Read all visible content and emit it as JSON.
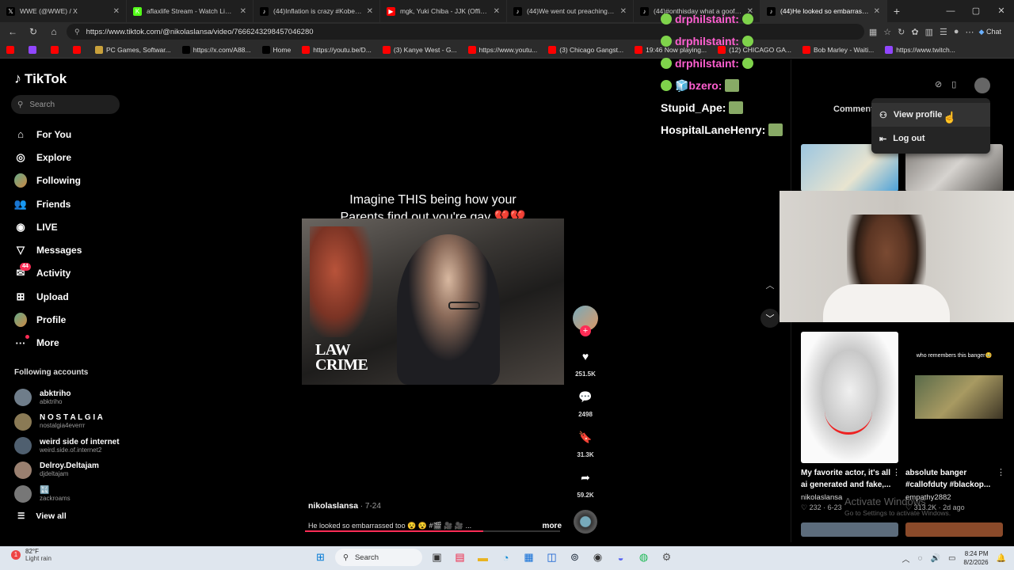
{
  "browser": {
    "tabs": [
      {
        "label": "WWE (@WWE) / X",
        "icon": "x-icon",
        "color": "#000000",
        "glyph": "𝕏"
      },
      {
        "label": "aflaxlife Stream - Watch Live on K",
        "icon": "kick-icon",
        "color": "#53fc18",
        "glyph": "K"
      },
      {
        "label": "(44)Inflation is crazy #Kobe | TikTok",
        "icon": "tiktok-icon",
        "color": "#000000",
        "glyph": "♪"
      },
      {
        "label": "mgk, Yuki Chiba - JJK (Official Vide",
        "icon": "youtube-icon",
        "color": "#ff0000",
        "glyph": "▶"
      },
      {
        "label": "(44)We went out preaching the G",
        "icon": "tiktok-icon",
        "color": "#000000",
        "glyph": "♪"
      },
      {
        "label": "(44)#onthisday what a goofball #",
        "icon": "tiktok-icon",
        "color": "#000000",
        "glyph": "♪"
      },
      {
        "label": "(44)He looked so embarrasse",
        "icon": "tiktok-icon",
        "color": "#000000",
        "glyph": "♪",
        "active": true
      }
    ],
    "url": "https://www.tiktok.com/@nikolaslansa/video/7666243298457046280",
    "chat_label": "Chat",
    "bookmarks": [
      {
        "label": "",
        "color": "#ff0000"
      },
      {
        "label": "",
        "color": "#9146ff"
      },
      {
        "label": "",
        "color": "#ff0000"
      },
      {
        "label": "",
        "color": "#ff0000"
      },
      {
        "label": "PC Games, Softwar...",
        "color": "#c9a13b"
      },
      {
        "label": "https://x.com/A88...",
        "color": "#000000"
      },
      {
        "label": "Home",
        "color": "#000000"
      },
      {
        "label": "https://youtu.be/D...",
        "color": "#ff0000"
      },
      {
        "label": "(3) Kanye West - G...",
        "color": "#ff0000"
      },
      {
        "label": "https://www.youtu...",
        "color": "#ff0000"
      },
      {
        "label": "(3) Chicago Gangst...",
        "color": "#ff0000"
      },
      {
        "label": "19:46 Now playing...",
        "color": "#ff0000"
      },
      {
        "label": "(12) CHICAGO GA...",
        "color": "#ff0000"
      },
      {
        "label": "Bob Marley - Waiti...",
        "color": "#ff0000"
      },
      {
        "label": "https://www.twitch...",
        "color": "#9146ff"
      }
    ]
  },
  "tiktok": {
    "logo": "TikTok",
    "search_placeholder": "Search",
    "nav": [
      {
        "label": "For You",
        "icon": "home-icon",
        "glyph": "⌂"
      },
      {
        "label": "Explore",
        "icon": "compass-icon",
        "glyph": "◎"
      },
      {
        "label": "Following",
        "icon": "following-avatar-icon",
        "glyph": ""
      },
      {
        "label": "Friends",
        "icon": "friends-icon",
        "glyph": "👥"
      },
      {
        "label": "LIVE",
        "icon": "live-icon",
        "glyph": "◉"
      },
      {
        "label": "Messages",
        "icon": "messages-icon",
        "glyph": "▽"
      },
      {
        "label": "Activity",
        "icon": "activity-icon",
        "glyph": "✉",
        "badge": "44"
      },
      {
        "label": "Upload",
        "icon": "upload-icon",
        "glyph": "⊞"
      },
      {
        "label": "Profile",
        "icon": "profile-avatar-icon",
        "glyph": ""
      },
      {
        "label": "More",
        "icon": "more-icon",
        "glyph": "···"
      }
    ],
    "following_title": "Following accounts",
    "following": [
      {
        "name": "abktriho",
        "user": "abktriho"
      },
      {
        "name": "N O S T A L G I A",
        "user": "nostalgia4everrr"
      },
      {
        "name": "weird side of internet",
        "user": "weird.side.of.internet2"
      },
      {
        "name": "Delroy.Deltajam",
        "user": "djdeltajam"
      },
      {
        "name": "🔣",
        "user": "zackroams"
      }
    ],
    "view_all": "View all"
  },
  "video": {
    "caption_line1": "Imagine THIS being how your",
    "caption_line2": "Parents find out you're gay 💔💔",
    "watermark_line1": "LAW",
    "watermark_line2": "CRIME",
    "author": "nikolaslansa",
    "date": " · 7-24",
    "description": "He looked so embarrassed too 😵 😵 #🎬 🎥 🎥 ...",
    "more": "more",
    "likes": "251.5K",
    "comments": "2498",
    "saves": "31.3K",
    "shares": "59.2K",
    "progress": 0.7
  },
  "stream_chat": [
    {
      "user": "drphilstaint:",
      "style": "green"
    },
    {
      "user": "drphilstaint:",
      "style": "green"
    },
    {
      "user": "drphilstaint:",
      "style": "green"
    },
    {
      "user": "🧊bzero:",
      "style": "green"
    },
    {
      "user": "Stupid_Ape:",
      "style": "white"
    },
    {
      "user": "HospitalLaneHenry:",
      "style": "white"
    }
  ],
  "right_panel": {
    "comments_tab": "Comment",
    "menu": {
      "view_profile": "View profile",
      "log_out": "Log out"
    },
    "rec_left": {
      "title": "My favorite actor, it's all ai generated and fake,...",
      "user": "nikolaslansa",
      "stats": "♡ 232 · 6-23"
    },
    "rec_right": {
      "overlay": "who remembers this banger🥹",
      "title": "absolute banger #callofduty #blackop...",
      "user": "empathy2882",
      "stats": "♡ 313.2K · 2d ago"
    },
    "activate_title": "Activate Windows",
    "activate_sub": "Go to Settings to activate Windows."
  },
  "taskbar": {
    "temp": "82°F",
    "weather": "Light rain",
    "search": "Search",
    "time": "8:24 PM",
    "date": "8/2/2026"
  }
}
